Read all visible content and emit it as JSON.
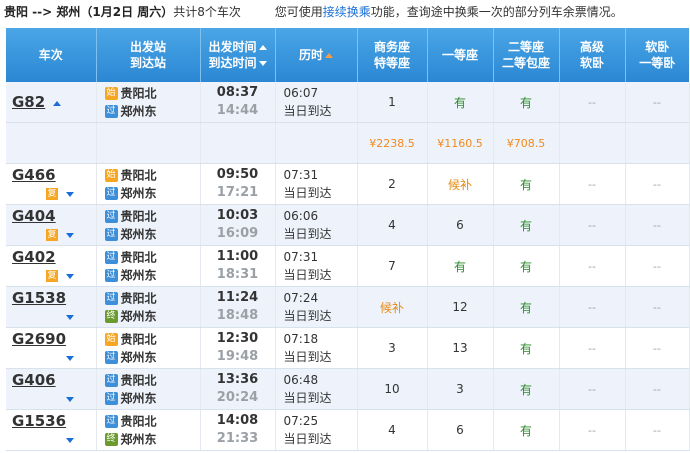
{
  "header": {
    "route": "贵阳 --> 郑州",
    "date": "（1月2日 周六）",
    "count": "共计8个车次",
    "tip_pre": "您可使用",
    "tip_link": "接续换乘",
    "tip_post": "功能，查询途中换乘一次的部分列车余票情况。"
  },
  "columns": {
    "train": "车次",
    "station_1": "出发站",
    "station_2": "到达站",
    "time_1": "出发时间",
    "time_2": "到达时间",
    "duration": "历时",
    "business_1": "商务座",
    "business_2": "特等座",
    "first": "一等座",
    "second_1": "二等座",
    "second_2": "二等包座",
    "soft_1": "高级",
    "soft_2": "软卧",
    "softbed_1": "软卧",
    "softbed_2": "一等卧"
  },
  "badges": {
    "start": "始",
    "pass": "过",
    "end": "终",
    "fu": "复"
  },
  "trains": [
    {
      "no": "G82",
      "dep_st": "贵阳北",
      "arr_st": "郑州东",
      "dep_badge": "始",
      "arr_badge": "过",
      "dep": "08:37",
      "arr": "14:44",
      "dur": "06:07",
      "day": "当日到达",
      "biz": "1",
      "first": "有",
      "second": "有",
      "soft": "--",
      "softbed": "--",
      "fu": "",
      "expanded": true
    },
    {
      "no": "G466",
      "dep_st": "贵阳北",
      "arr_st": "郑州东",
      "dep_badge": "始",
      "arr_badge": "过",
      "dep": "09:50",
      "arr": "17:21",
      "dur": "07:31",
      "day": "当日到达",
      "biz": "2",
      "first": "候补",
      "second": "有",
      "soft": "--",
      "softbed": "--",
      "fu": "复"
    },
    {
      "no": "G404",
      "dep_st": "贵阳北",
      "arr_st": "郑州东",
      "dep_badge": "过",
      "arr_badge": "过",
      "dep": "10:03",
      "arr": "16:09",
      "dur": "06:06",
      "day": "当日到达",
      "biz": "4",
      "first": "6",
      "second": "有",
      "soft": "--",
      "softbed": "--",
      "fu": "复"
    },
    {
      "no": "G402",
      "dep_st": "贵阳北",
      "arr_st": "郑州东",
      "dep_badge": "过",
      "arr_badge": "过",
      "dep": "11:00",
      "arr": "18:31",
      "dur": "07:31",
      "day": "当日到达",
      "biz": "7",
      "first": "有",
      "second": "有",
      "soft": "--",
      "softbed": "--",
      "fu": "复"
    },
    {
      "no": "G1538",
      "dep_st": "贵阳北",
      "arr_st": "郑州东",
      "dep_badge": "过",
      "arr_badge": "终",
      "dep": "11:24",
      "arr": "18:48",
      "dur": "07:24",
      "day": "当日到达",
      "biz": "候补",
      "first": "12",
      "second": "有",
      "soft": "--",
      "softbed": "--",
      "fu": ""
    },
    {
      "no": "G2690",
      "dep_st": "贵阳北",
      "arr_st": "郑州东",
      "dep_badge": "始",
      "arr_badge": "过",
      "dep": "12:30",
      "arr": "19:48",
      "dur": "07:18",
      "day": "当日到达",
      "biz": "3",
      "first": "13",
      "second": "有",
      "soft": "--",
      "softbed": "--",
      "fu": ""
    },
    {
      "no": "G406",
      "dep_st": "贵阳北",
      "arr_st": "郑州东",
      "dep_badge": "过",
      "arr_badge": "过",
      "dep": "13:36",
      "arr": "20:24",
      "dur": "06:48",
      "day": "当日到达",
      "biz": "10",
      "first": "3",
      "second": "有",
      "soft": "--",
      "softbed": "--",
      "fu": ""
    },
    {
      "no": "G1536",
      "dep_st": "贵阳北",
      "arr_st": "郑州东",
      "dep_badge": "过",
      "arr_badge": "终",
      "dep": "14:08",
      "arr": "21:33",
      "dur": "07:25",
      "day": "当日到达",
      "biz": "4",
      "first": "6",
      "second": "有",
      "soft": "--",
      "softbed": "--",
      "fu": ""
    }
  ],
  "prices": {
    "biz": "¥2238.5",
    "first": "¥1160.5",
    "second": "¥708.5"
  },
  "colors": {
    "header_blue": "#2b87d3",
    "available_green": "#2a8a2a",
    "waitlist_orange": "#e58a10",
    "price_orange": "#f08a1c"
  }
}
